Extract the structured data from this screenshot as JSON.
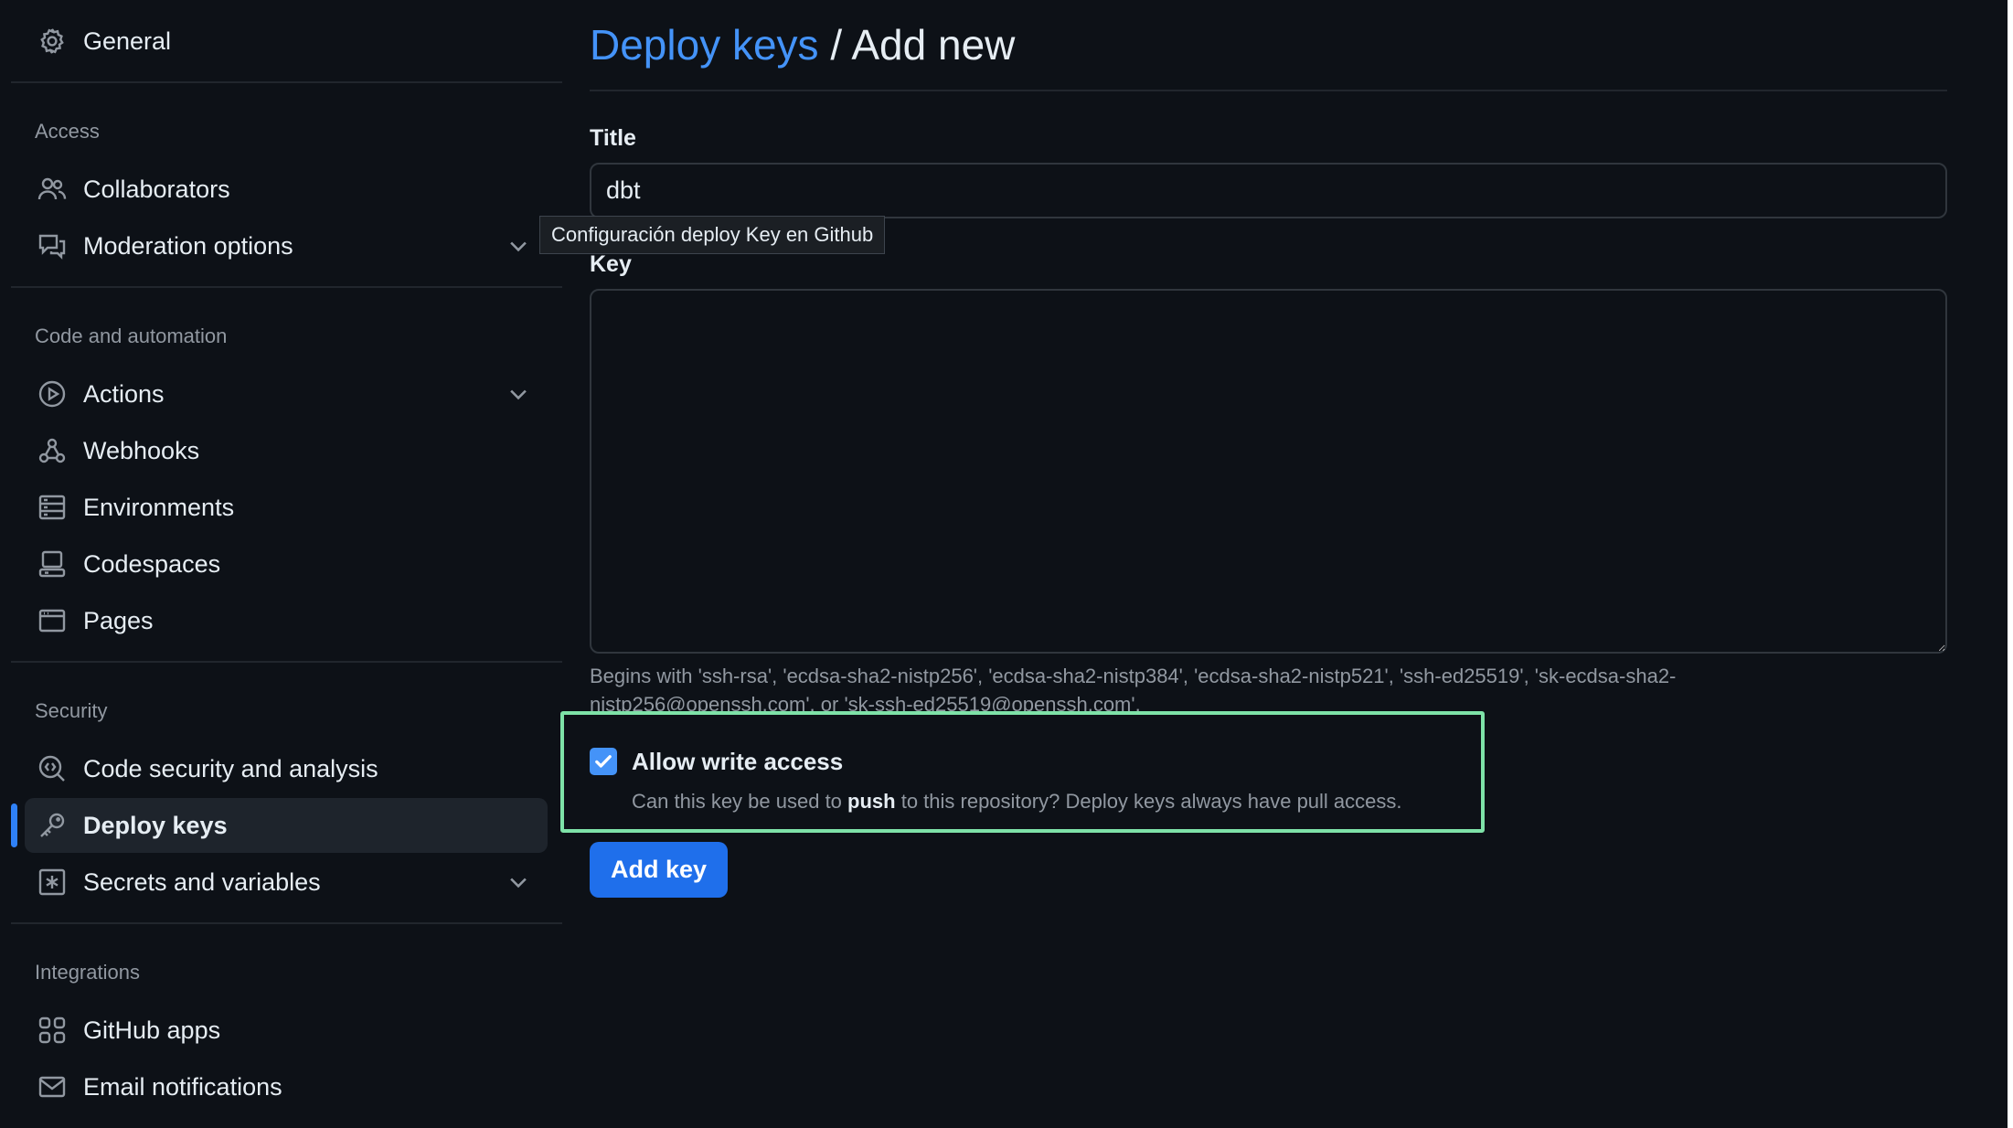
{
  "sidebar": {
    "general": "General",
    "sections": {
      "access": "Access",
      "code_automation": "Code and automation",
      "security": "Security",
      "integrations": "Integrations"
    },
    "items": {
      "collaborators": "Collaborators",
      "moderation": "Moderation options",
      "actions": "Actions",
      "webhooks": "Webhooks",
      "environments": "Environments",
      "codespaces": "Codespaces",
      "pages": "Pages",
      "code_security": "Code security and analysis",
      "deploy_keys": "Deploy keys",
      "secrets": "Secrets and variables",
      "github_apps": "GitHub apps",
      "email_notifications": "Email notifications"
    },
    "active_item": "Deploy keys"
  },
  "page": {
    "breadcrumb_link": "Deploy keys",
    "separator": " / ",
    "current": "Add new"
  },
  "form": {
    "title_label": "Title",
    "title_value": "dbt",
    "key_label": "Key",
    "key_value": "",
    "key_hint": "Begins with 'ssh-rsa', 'ecdsa-sha2-nistp256', 'ecdsa-sha2-nistp384', 'ecdsa-sha2-nistp521', 'ssh-ed25519', 'sk-ecdsa-sha2-nistp256@openssh.com', or 'sk-ssh-ed25519@openssh.com'.",
    "write_access_label": "Allow write access",
    "write_access_checked": true,
    "write_access_desc_before": "Can this key be used to ",
    "write_access_desc_bold": "push",
    "write_access_desc_after": " to this repository? Deploy keys always have pull access.",
    "submit_label": "Add key"
  },
  "tooltip": "Configuración deploy Key en Github",
  "colors": {
    "background": "#0d1117",
    "accent": "#4493f8",
    "button": "#1f6feb",
    "highlight": "#7ee2a8"
  },
  "icons": {
    "general": "gear-icon",
    "collaborators": "people-icon",
    "moderation": "comment-icon",
    "actions": "play-icon",
    "webhooks": "webhook-icon",
    "environments": "server-icon",
    "codespaces": "codespaces-icon",
    "pages": "browser-icon",
    "code_security": "codescan-icon",
    "deploy_keys": "key-icon",
    "secrets": "key-asterisk-icon",
    "github_apps": "apps-icon",
    "email_notifications": "mail-icon",
    "expand": "chevron-down-icon"
  }
}
